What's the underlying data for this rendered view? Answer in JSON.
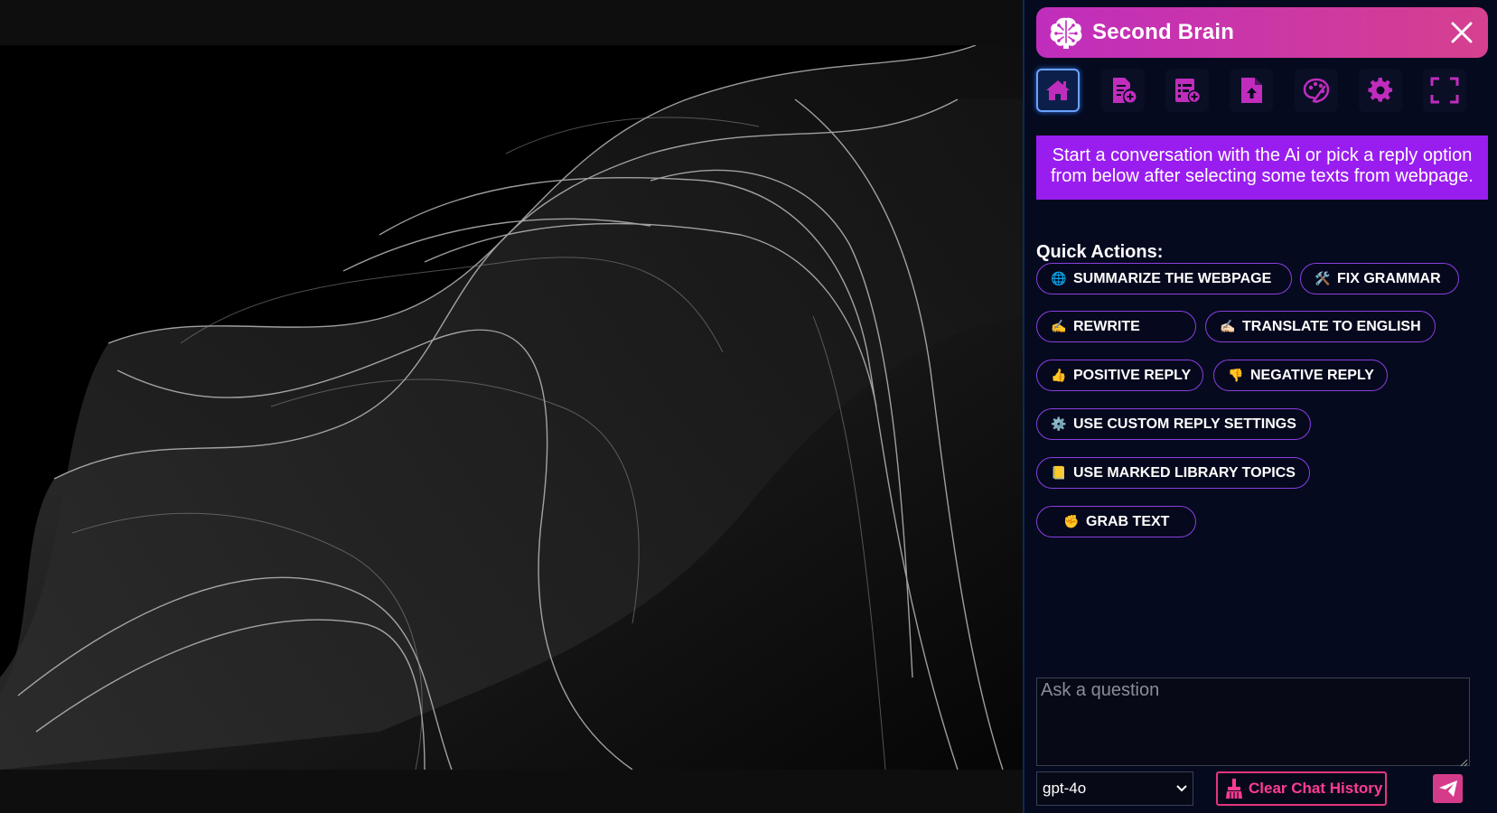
{
  "panel": {
    "title": "Second Brain",
    "accent_color": "#c02dbd",
    "header_gradient_end": "#d6408f",
    "toolbar": [
      {
        "icon": "home-icon",
        "active": true
      },
      {
        "icon": "add-document-icon",
        "active": false
      },
      {
        "icon": "add-list-icon",
        "active": false
      },
      {
        "icon": "upload-file-icon",
        "active": false
      },
      {
        "icon": "palette-icon",
        "active": false
      },
      {
        "icon": "gear-icon",
        "active": false
      },
      {
        "icon": "fullscreen-icon",
        "active": false
      }
    ],
    "banner_text": "Start a conversation with the Ai or pick a reply option from below after selecting some texts from webpage.",
    "banner_color": "#9a1df0",
    "quick_actions_heading": "Quick Actions:",
    "quick_actions": [
      {
        "emoji": "🌐",
        "icon": "globe-icon",
        "label": "SUMMARIZE THE WEBPAGE"
      },
      {
        "emoji": "🛠️",
        "icon": "tools-icon",
        "label": "FIX GRAMMAR"
      },
      {
        "emoji": "✍️",
        "icon": "writing-hand-icon",
        "label": "REWRITE"
      },
      {
        "emoji": "✍🏻",
        "icon": "writing-hand-icon",
        "label": "TRANSLATE TO ENGLISH"
      },
      {
        "emoji": "👍",
        "icon": "thumbs-up-icon",
        "label": "POSITIVE REPLY"
      },
      {
        "emoji": "👎",
        "icon": "thumbs-down-icon",
        "label": "NEGATIVE REPLY"
      },
      {
        "emoji": "⚙️",
        "icon": "gear-icon",
        "label": "USE CUSTOM REPLY SETTINGS"
      },
      {
        "emoji": "📒",
        "icon": "notebook-icon",
        "label": "USE MARKED LIBRARY TOPICS"
      },
      {
        "emoji": "✊",
        "icon": "fist-icon",
        "label": "GRAB TEXT"
      }
    ],
    "question_placeholder": "Ask a question",
    "question_value": "",
    "model_selected": "gpt-4o",
    "clear_button_label": "Clear Chat History",
    "clear_button_color": "#ff3c93"
  }
}
